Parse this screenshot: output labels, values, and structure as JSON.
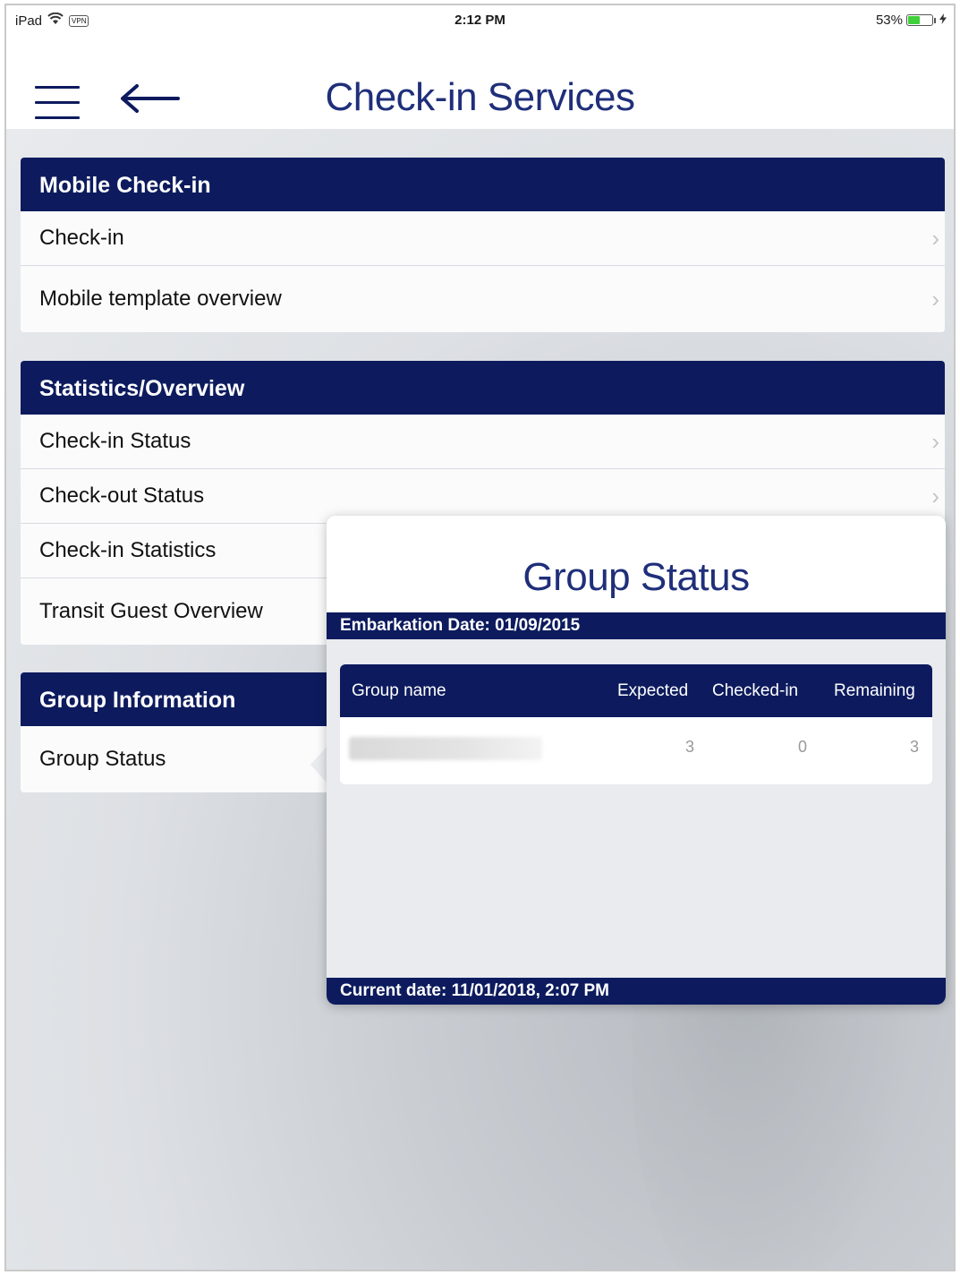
{
  "status_bar": {
    "device": "iPad",
    "vpn": "VPN",
    "time": "2:12 PM",
    "battery_percent": "53%",
    "battery_level": 0.53,
    "charging_icon": "bolt-icon"
  },
  "nav": {
    "title": "Check-in Services",
    "menu_icon": "hamburger-menu-icon",
    "back_icon": "arrow-left-icon"
  },
  "sections": {
    "mobile": {
      "header": "Mobile Check-in",
      "items": [
        "Check-in",
        "Mobile template overview"
      ]
    },
    "stats": {
      "header": "Statistics/Overview",
      "items": [
        "Check-in Status",
        "Check-out Status",
        "Check-in Statistics",
        "Transit Guest Overview"
      ]
    },
    "group": {
      "header": "Group Information",
      "items": [
        "Group Status"
      ]
    }
  },
  "popover": {
    "title": "Group Status",
    "embarkation": "Embarkation Date:  01/09/2015",
    "columns": {
      "name": "Group name",
      "expected": "Expected",
      "checked_in": "Checked-in",
      "remaining": "Remaining"
    },
    "rows": [
      {
        "name": "",
        "expected": "3",
        "checked_in": "0",
        "remaining": "3"
      }
    ],
    "current_date": "Current date: 11/01/2018, 2:07 PM"
  },
  "colors": {
    "navy": "#0d1b5e",
    "title_blue": "#1f2f7a",
    "battery_green": "#3fd13a"
  }
}
